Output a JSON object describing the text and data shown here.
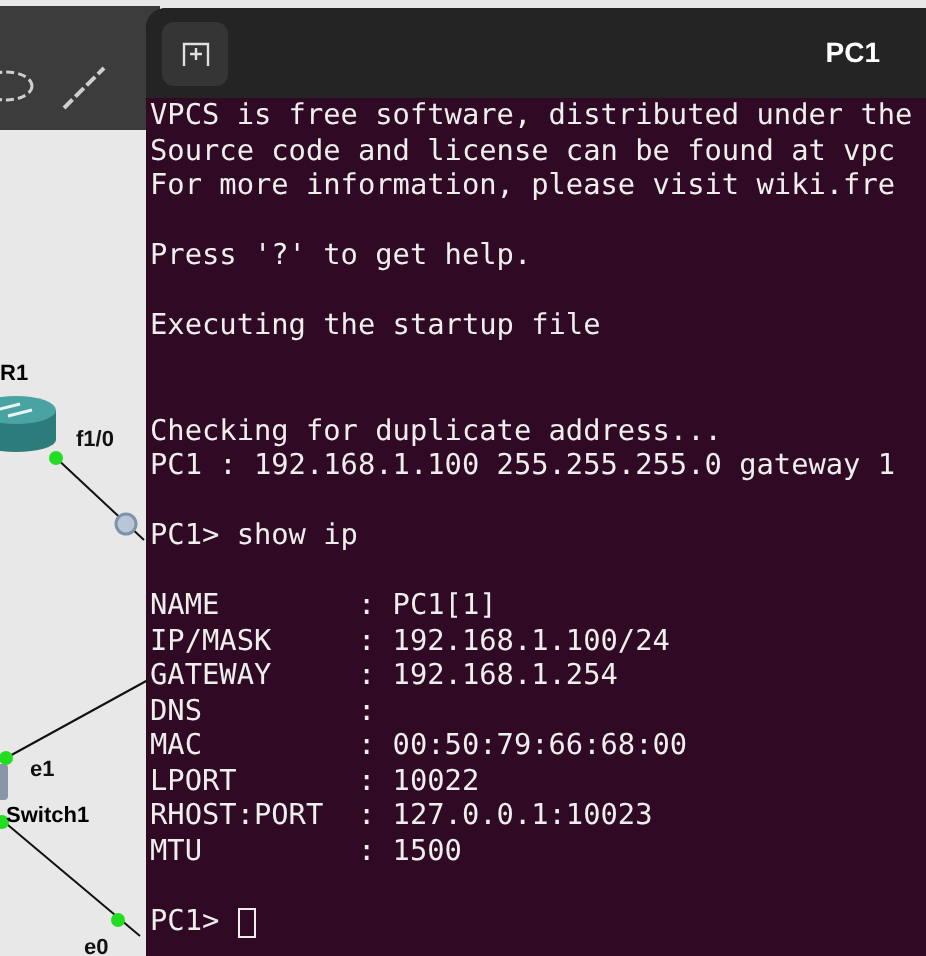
{
  "canvas": {
    "labels": [
      {
        "kind": "device",
        "text": "R1"
      },
      {
        "kind": "port",
        "text": "f1/0"
      },
      {
        "kind": "port",
        "text": "e1"
      },
      {
        "kind": "device",
        "text": "Switch1"
      },
      {
        "kind": "port",
        "text": "e0"
      }
    ]
  },
  "terminal": {
    "title": "PC1",
    "blocks": [
      {
        "kind": "message",
        "lines": [
          "VPCS is free software, distributed under the",
          "Source code and license can be found at vpc",
          "For more information, please visit wiki.fre"
        ]
      },
      {
        "kind": "message",
        "lines": [
          "Press '?' to get help."
        ]
      },
      {
        "kind": "script",
        "lines": [
          "Executing the startup file"
        ]
      },
      {
        "kind": "message",
        "lines": [
          "Checking for duplicate address...",
          "PC1 : 192.168.1.100 255.255.255.0 gateway 1"
        ]
      },
      {
        "kind": "command",
        "lines": [
          "PC1> show ip"
        ]
      },
      {
        "kind": "message",
        "lines": [
          "NAME        : PC1[1]",
          "IP/MASK     : 192.168.1.100/24",
          "GATEWAY     : 192.168.1.254",
          "DNS         :",
          "MAC         : 00:50:79:66:68:00",
          "LPORT       : 10022",
          "RHOST:PORT  : 127.0.0.1:10023",
          "MTU         : 1500"
        ]
      }
    ],
    "prompt": "PC1>",
    "cursor": true
  }
}
